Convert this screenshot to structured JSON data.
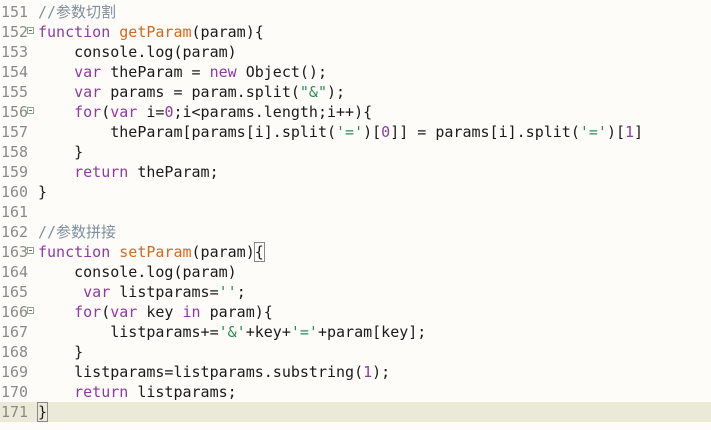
{
  "editor": {
    "lines": [
      {
        "num": "151",
        "fold": false,
        "current": false,
        "tokens": [
          {
            "t": "//参数切割",
            "c": "cmt"
          }
        ]
      },
      {
        "num": "152",
        "fold": true,
        "current": false,
        "tokens": [
          {
            "t": "function ",
            "c": "kw"
          },
          {
            "t": "getParam",
            "c": "fn"
          },
          {
            "t": "(param){",
            "c": ""
          }
        ]
      },
      {
        "num": "153",
        "fold": false,
        "current": false,
        "tokens": [
          {
            "t": "    console.log(param)",
            "c": ""
          }
        ]
      },
      {
        "num": "154",
        "fold": false,
        "current": false,
        "tokens": [
          {
            "t": "    ",
            "c": ""
          },
          {
            "t": "var",
            "c": "kw"
          },
          {
            "t": " theParam = ",
            "c": ""
          },
          {
            "t": "new",
            "c": "kw"
          },
          {
            "t": " Object();",
            "c": ""
          }
        ]
      },
      {
        "num": "155",
        "fold": false,
        "current": false,
        "tokens": [
          {
            "t": "    ",
            "c": ""
          },
          {
            "t": "var",
            "c": "kw"
          },
          {
            "t": " params = param.split(",
            "c": ""
          },
          {
            "t": "\"&\"",
            "c": "str"
          },
          {
            "t": ");",
            "c": ""
          }
        ]
      },
      {
        "num": "156",
        "fold": true,
        "current": false,
        "tokens": [
          {
            "t": "    ",
            "c": ""
          },
          {
            "t": "for",
            "c": "kw"
          },
          {
            "t": "(",
            "c": ""
          },
          {
            "t": "var",
            "c": "kw"
          },
          {
            "t": " i=",
            "c": ""
          },
          {
            "t": "0",
            "c": "num"
          },
          {
            "t": ";i<params.length;i++){",
            "c": ""
          }
        ]
      },
      {
        "num": "157",
        "fold": false,
        "current": false,
        "tokens": [
          {
            "t": "        theParam[params[i].split(",
            "c": ""
          },
          {
            "t": "'='",
            "c": "str"
          },
          {
            "t": ")[",
            "c": ""
          },
          {
            "t": "0",
            "c": "num"
          },
          {
            "t": "]] = params[i].split(",
            "c": ""
          },
          {
            "t": "'='",
            "c": "str"
          },
          {
            "t": ")[",
            "c": ""
          },
          {
            "t": "1",
            "c": "num"
          },
          {
            "t": "]",
            "c": ""
          }
        ]
      },
      {
        "num": "158",
        "fold": false,
        "current": false,
        "tokens": [
          {
            "t": "    }",
            "c": ""
          }
        ]
      },
      {
        "num": "159",
        "fold": false,
        "current": false,
        "tokens": [
          {
            "t": "    ",
            "c": ""
          },
          {
            "t": "return",
            "c": "kw"
          },
          {
            "t": " theParam;",
            "c": ""
          }
        ]
      },
      {
        "num": "160",
        "fold": false,
        "current": false,
        "tokens": [
          {
            "t": "}",
            "c": ""
          }
        ]
      },
      {
        "num": "161",
        "fold": false,
        "current": false,
        "tokens": []
      },
      {
        "num": "162",
        "fold": false,
        "current": false,
        "tokens": [
          {
            "t": "//参数拼接",
            "c": "cmt"
          }
        ]
      },
      {
        "num": "163",
        "fold": true,
        "current": false,
        "tokens": [
          {
            "t": "function ",
            "c": "kw"
          },
          {
            "t": "setParam",
            "c": "fn"
          },
          {
            "t": "(param)",
            "c": ""
          },
          {
            "t": "{",
            "c": "hl"
          }
        ]
      },
      {
        "num": "164",
        "fold": false,
        "current": false,
        "tokens": [
          {
            "t": "    console.log(param)",
            "c": ""
          }
        ]
      },
      {
        "num": "165",
        "fold": false,
        "current": false,
        "tokens": [
          {
            "t": "     ",
            "c": ""
          },
          {
            "t": "var",
            "c": "kw"
          },
          {
            "t": " listparams=",
            "c": ""
          },
          {
            "t": "''",
            "c": "str"
          },
          {
            "t": ";",
            "c": ""
          }
        ]
      },
      {
        "num": "166",
        "fold": true,
        "current": false,
        "tokens": [
          {
            "t": "    ",
            "c": ""
          },
          {
            "t": "for",
            "c": "kw"
          },
          {
            "t": "(",
            "c": ""
          },
          {
            "t": "var",
            "c": "kw"
          },
          {
            "t": " key ",
            "c": ""
          },
          {
            "t": "in",
            "c": "kw"
          },
          {
            "t": " param){",
            "c": ""
          }
        ]
      },
      {
        "num": "167",
        "fold": false,
        "current": false,
        "tokens": [
          {
            "t": "        listparams+=",
            "c": ""
          },
          {
            "t": "'&'",
            "c": "str"
          },
          {
            "t": "+key+",
            "c": ""
          },
          {
            "t": "'='",
            "c": "str"
          },
          {
            "t": "+param[key];",
            "c": ""
          }
        ]
      },
      {
        "num": "168",
        "fold": false,
        "current": false,
        "tokens": [
          {
            "t": "    }",
            "c": ""
          }
        ]
      },
      {
        "num": "169",
        "fold": false,
        "current": false,
        "tokens": [
          {
            "t": "    listparams=listparams.substring(",
            "c": ""
          },
          {
            "t": "1",
            "c": "num"
          },
          {
            "t": ");",
            "c": ""
          }
        ]
      },
      {
        "num": "170",
        "fold": false,
        "current": false,
        "tokens": [
          {
            "t": "    ",
            "c": ""
          },
          {
            "t": "return",
            "c": "kw"
          },
          {
            "t": " listparams;",
            "c": ""
          }
        ]
      },
      {
        "num": "171",
        "fold": false,
        "current": true,
        "tokens": [
          {
            "t": "}",
            "c": "hl"
          },
          {
            "t": "",
            "c": "caret"
          }
        ]
      }
    ]
  },
  "colors": {
    "background": "#fdfcf8",
    "current_line": "#ebe9d8",
    "line_number": "#8a8a8a",
    "comment": "#7f8f9f",
    "keyword": "#8f3aa4",
    "function_name": "#d2691e",
    "string": "#2e8b57",
    "number": "#8f3aa4"
  },
  "icons": {
    "fold_marker": "fold-collapse-icon"
  }
}
